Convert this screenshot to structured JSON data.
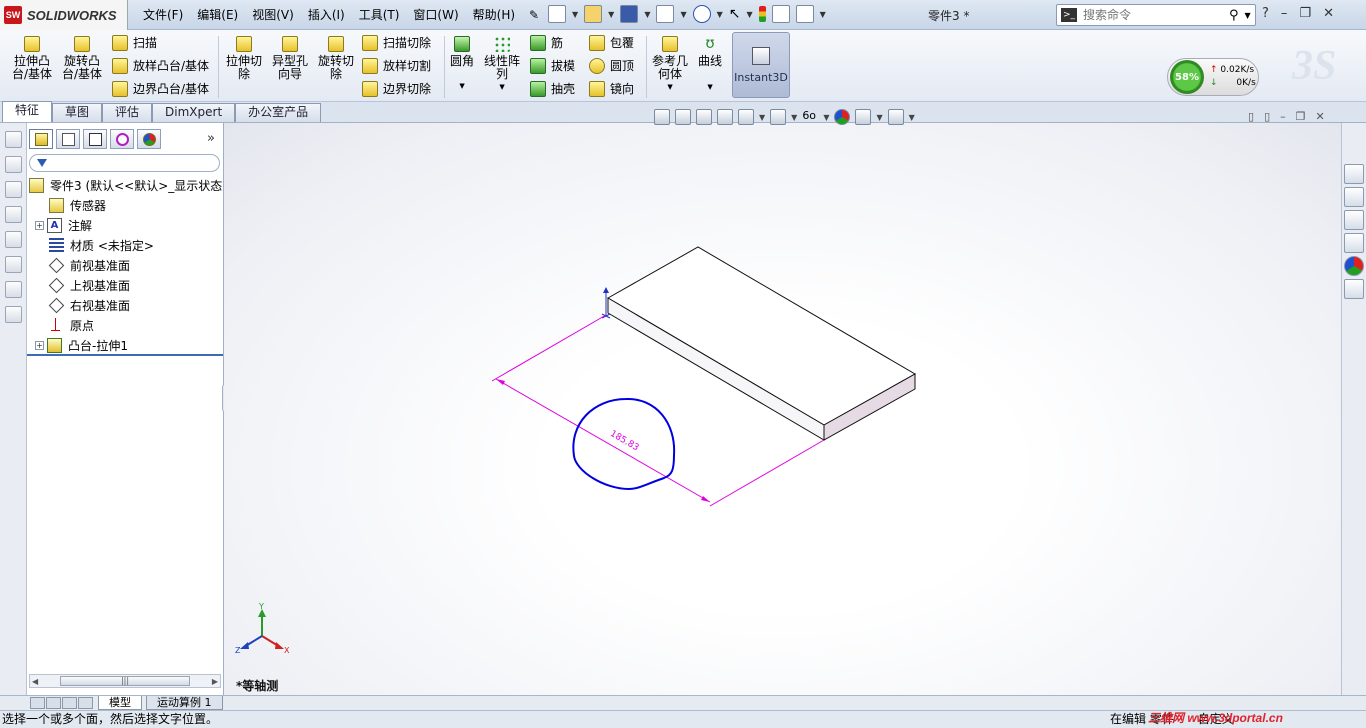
{
  "app": {
    "brand": "SOLIDWORKS",
    "brand_mark": "SW",
    "document_title": "零件3 *"
  },
  "menu": [
    "文件(F)",
    "编辑(E)",
    "视图(V)",
    "插入(I)",
    "工具(T)",
    "窗口(W)",
    "帮助(H)"
  ],
  "search": {
    "placeholder": "搜索命令"
  },
  "window_controls": [
    "?",
    "–",
    "❐",
    "✕"
  ],
  "command_manager": {
    "boss_extrude": "拉伸凸\n台/基体",
    "revolve_boss": "旋转凸\n台/基体",
    "sweep": "扫描",
    "loft_boss": "放样凸台/基体",
    "boundary_boss": "边界凸台/基体",
    "extrude_cut": "拉伸切\n除",
    "hole_wizard": "异型孔\n向导",
    "revolve_cut": "旋转切\n除",
    "sweep_cut": "扫描切除",
    "loft_cut": "放样切割",
    "boundary_cut": "边界切除",
    "fillet": "圆角",
    "linear_pattern": "线性阵\n列",
    "rib": "筋",
    "draft": "拔模",
    "shell": "抽壳",
    "wrap": "包覆",
    "dome": "圆顶",
    "mirror": "镜向",
    "ref_geometry": "参考几\n何体",
    "curves": "曲线",
    "instant3d": "Instant3D"
  },
  "performance": {
    "cpu": "58%",
    "upload": "0.02K/s",
    "download": "0K/s"
  },
  "tabs": [
    "特征",
    "草图",
    "评估",
    "DimXpert",
    "办公室产品"
  ],
  "active_tab": "特征",
  "feature_tree": {
    "root": "零件3 (默认<<默认>_显示状态",
    "items": [
      {
        "label": "传感器",
        "icon": "sensor-icon",
        "expandable": false
      },
      {
        "label": "注解",
        "icon": "annotation-icon",
        "expandable": true
      },
      {
        "label": "材质 <未指定>",
        "icon": "material-icon",
        "expandable": false
      },
      {
        "label": "前视基准面",
        "icon": "plane-icon",
        "expandable": false
      },
      {
        "label": "上视基准面",
        "icon": "plane-icon",
        "expandable": false
      },
      {
        "label": "右视基准面",
        "icon": "plane-icon",
        "expandable": false
      },
      {
        "label": "原点",
        "icon": "origin-icon",
        "expandable": false
      },
      {
        "label": "凸台-拉伸1",
        "icon": "extrude-icon",
        "expandable": true
      }
    ]
  },
  "viewport": {
    "view_label": "*等轴测",
    "dimension_text": "185.83",
    "axis_labels": {
      "x": "X",
      "y": "Y",
      "z": "Z"
    },
    "colors": {
      "sketch": "#0000e0",
      "dimension": "#e000e0",
      "background": "#ffffff"
    }
  },
  "bottom_tabs": [
    "模型",
    "运动算例 1"
  ],
  "status": {
    "message": "选择一个或多个面，然后选择文字位置。",
    "mode": "在编辑 零件",
    "units": "自定义"
  },
  "watermark": "三维网 www.3dportal.cn"
}
